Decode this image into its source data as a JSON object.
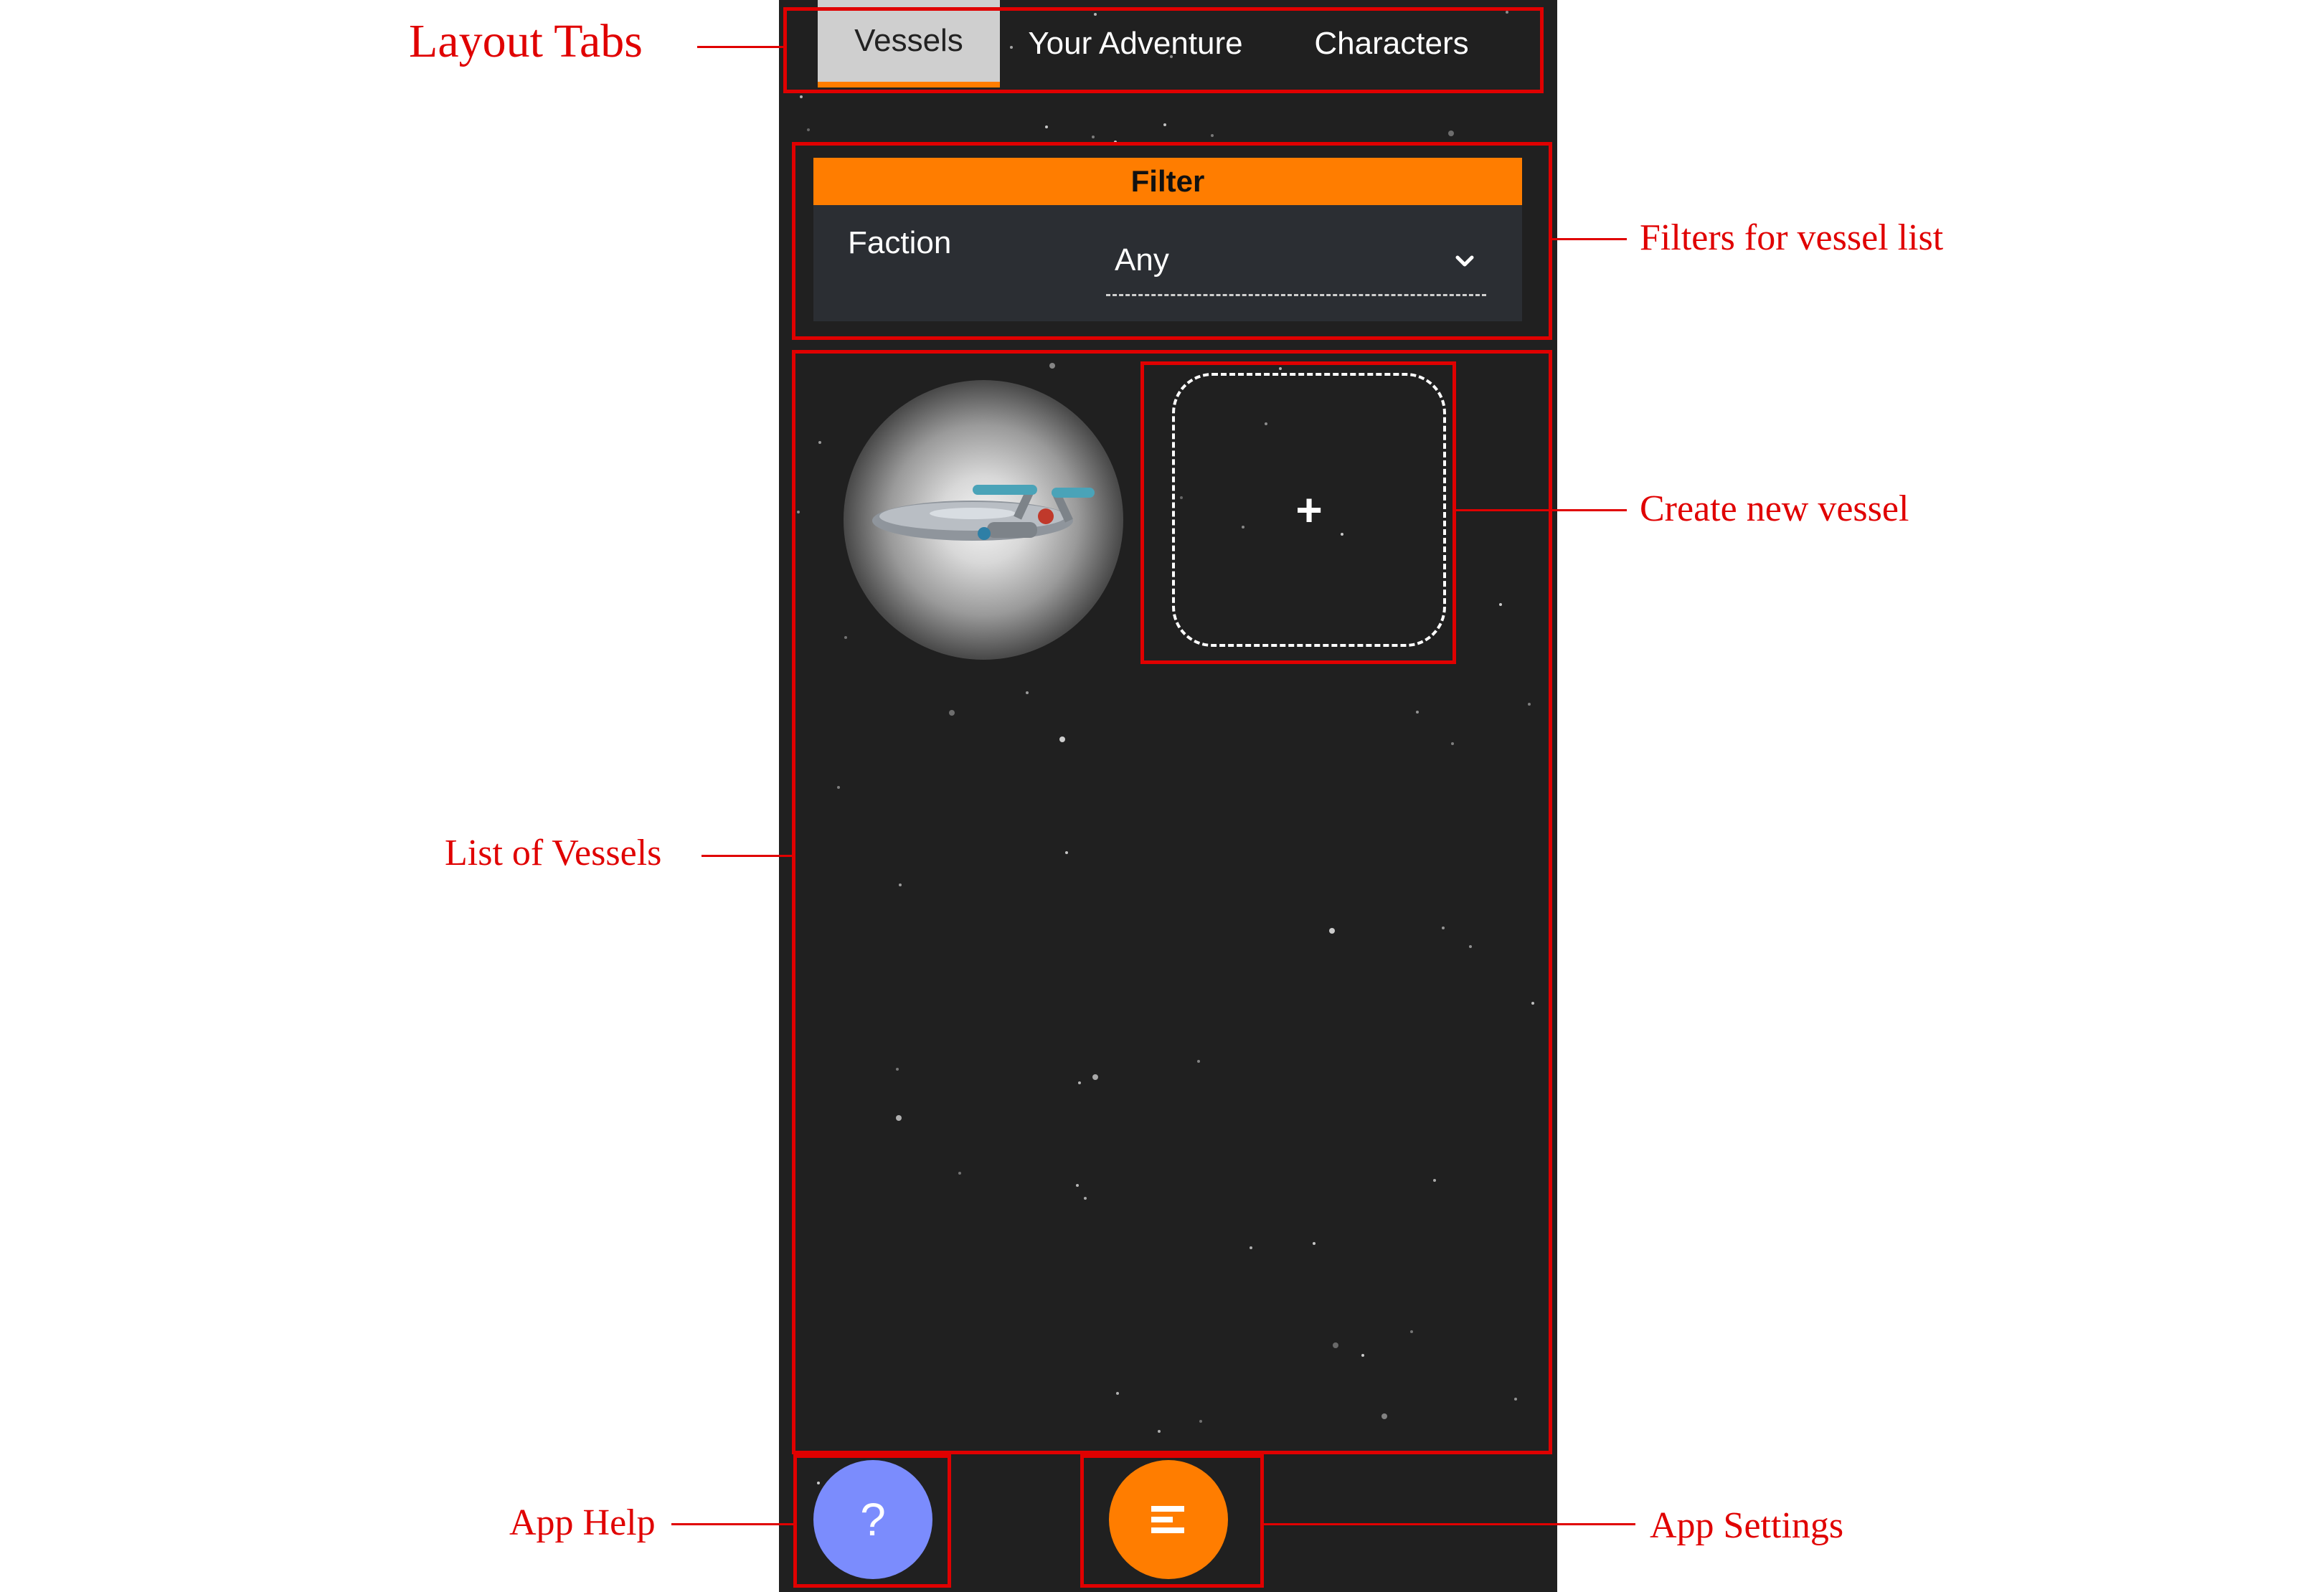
{
  "tabs": [
    {
      "label": "Vessels",
      "active": true
    },
    {
      "label": "Your Adventure",
      "active": false
    },
    {
      "label": "Characters",
      "active": false
    }
  ],
  "filter": {
    "title": "Filter",
    "faction_label": "Faction",
    "faction_value": "Any"
  },
  "vessels": {
    "items": [
      {
        "icon": "starship-image"
      }
    ],
    "add_label": "+"
  },
  "buttons": {
    "help_label": "?",
    "settings_icon": "menu-icon"
  },
  "annotations": {
    "layout_tabs": "Layout Tabs",
    "filters": "Filters for vessel list",
    "create_vessel": "Create new vessel",
    "list_vessels": "List of Vessels",
    "app_help": "App Help",
    "app_settings": "App Settings"
  },
  "colors": {
    "accent": "#ff7d00",
    "annotation": "#e00000",
    "help": "#7b8cfd",
    "background": "#202020"
  }
}
